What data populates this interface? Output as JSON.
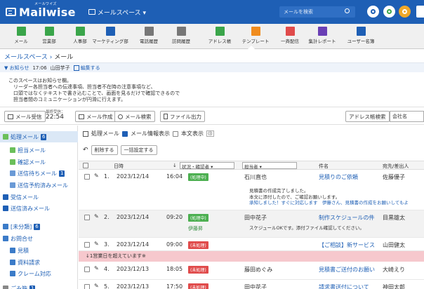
{
  "header": {
    "logo_ruby": "メールワイズ",
    "logo": "Mailwise",
    "space_selector": "メールスペース ▾",
    "search_placeholder": "メールを検索"
  },
  "apps": [
    {
      "label": "メール",
      "color": "#3aa54a"
    },
    {
      "label": "営業部",
      "color": "#3aa54a"
    },
    {
      "label": "人事部",
      "color": "#3aa54a"
    },
    {
      "label": "マーケティング部",
      "color": "#1e5fb5"
    },
    {
      "label": "電話履歴",
      "color": "#777777"
    },
    {
      "label": "訪問履歴",
      "color": "#777777"
    },
    {
      "label": "アドレス帳",
      "color": "#3aa54a"
    },
    {
      "label": "テンプレート",
      "color": "#f08c1e"
    },
    {
      "label": "一斉配信",
      "color": "#e04b4b"
    },
    {
      "label": "集計レポート",
      "color": "#6a3fb5"
    },
    {
      "label": "ユーザー名簿",
      "color": "#1e5fb5"
    }
  ],
  "breadcrumb": {
    "link": "メールスペース",
    "sep": "›",
    "current": "メール"
  },
  "notice": {
    "title": "▼ お知らせ",
    "time": "17:06",
    "author": "山田芋子",
    "edit": "編集する",
    "lines": [
      "このスペースはお知らせ欄。",
      "　リーダー各担当者への伝達事項、担当者不在時の注意事項など、",
      "　口頭ではなくテキストで書き込むことで、画面を見るだけで確認できるので",
      "　担当者間のコミュニケーションが円滑に行えます。"
    ]
  },
  "toolbar": {
    "receive": "メール受信",
    "last_recv_label": "最終受信：",
    "last_recv_time": "22:54",
    "compose": "メール作成",
    "search": "メール検索",
    "export": "ファイル出力",
    "address_search": "アドレス帳検索",
    "company": "会社名"
  },
  "sidebar": [
    {
      "label": "処理メール",
      "badge": "6"
    },
    {
      "label": "担当メール",
      "badge": ""
    },
    {
      "label": "確認メール",
      "badge": ""
    },
    {
      "label": "送信待ちメール",
      "badge": "1"
    },
    {
      "label": "送信予約済みメール",
      "badge": ""
    },
    {
      "label": "受信メール",
      "badge": ""
    },
    {
      "label": "送信済みメール",
      "badge": ""
    },
    {
      "label": "[未分類]",
      "badge": "6"
    },
    {
      "label": "お問合せ",
      "badge": ""
    },
    {
      "label": "見積",
      "badge": ""
    },
    {
      "label": "資料請求",
      "badge": ""
    },
    {
      "label": "クレーム対応",
      "badge": ""
    },
    {
      "label": "ごみ箱",
      "badge": "1"
    }
  ],
  "content": {
    "title": "処理メール",
    "opt1": "メール情報表示",
    "opt2": "本文表示",
    "delete": "削除する",
    "bulk": "一括設定する",
    "cols": {
      "date": "日時",
      "status": "状況・確認者",
      "assignee": "担当者",
      "subject": "件名",
      "sender": "宛先/差出人"
    }
  },
  "rows": [
    {
      "num": "1.",
      "date": "2023/12/14",
      "time": "16:04",
      "status": "(処理中)",
      "assignee": "石川直也",
      "subject": "見積りのご依頼",
      "sender": "佐藤優子",
      "preview": [
        "見積書の作成完了しました。",
        "本文に添付したので、ご確認お願いします。",
        "承知しました！すぐに対応します　伊藤さん、見積書の作成をお願いしてもよ"
      ]
    },
    {
      "num": "2.",
      "date": "2023/12/14",
      "time": "09:20",
      "status": "(処理中)",
      "status_user": "伊藤昇",
      "assignee": "田中花子",
      "subject": "制作スケジュールの件",
      "sender": "目黒雄太",
      "preview": [
        "スケジュールOKです。添付ファイル確認してください。"
      ]
    },
    {
      "num": "3.",
      "date": "2023/12/14",
      "time": "09:00",
      "status": "(未処理)",
      "assignee": "",
      "subject": "【ご相談】新サービス",
      "sender": "山田健太"
    },
    {
      "num": "4.",
      "date": "2023/12/13",
      "time": "18:05",
      "status": "(未処理)",
      "assignee": "藤田めぐみ",
      "subject": "見積書ご送付のお願い",
      "sender": "大崎えり"
    },
    {
      "num": "5.",
      "date": "2023/12/13",
      "time": "17:50",
      "status": "(未処理)",
      "assignee": "田中花子",
      "subject": "請求書送付について",
      "sender": "神田太郎"
    }
  ],
  "overdue": "↓1営業日を超えています※"
}
